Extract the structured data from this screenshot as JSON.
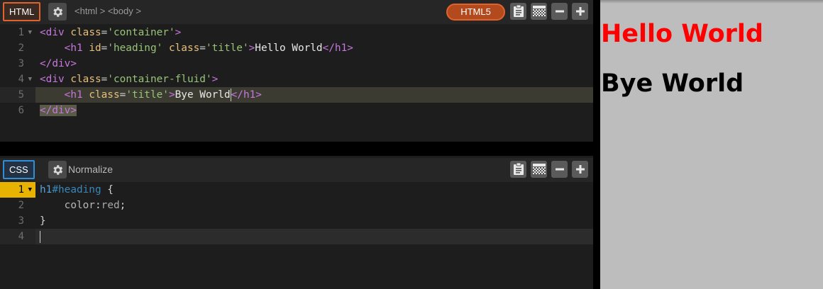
{
  "html_panel": {
    "lang_label": "HTML",
    "breadcrumb": "<html > <body >",
    "doctype_label": "HTML5",
    "lines": [
      {
        "num": "1",
        "fold": true
      },
      {
        "num": "2",
        "fold": false
      },
      {
        "num": "3",
        "fold": false
      },
      {
        "num": "4",
        "fold": true
      },
      {
        "num": "5",
        "fold": false
      },
      {
        "num": "6",
        "fold": false
      }
    ]
  },
  "html_code": {
    "l1": {
      "open": "<div ",
      "attr1": "class",
      "eq1": "=",
      "val1": "'container'",
      "close": ">"
    },
    "l2": {
      "indent": "    ",
      "open": "<h1 ",
      "attr1": "id",
      "eq1": "=",
      "val1": "'heading'",
      "sp": " ",
      "attr2": "class",
      "eq2": "=",
      "val2": "'title'",
      "gt": ">",
      "txt": "Hello World",
      "end": "</h1>"
    },
    "l3": {
      "end": "</div>"
    },
    "l4": {
      "open": "<div ",
      "attr1": "class",
      "eq1": "=",
      "val1": "'container-fluid'",
      "close": ">"
    },
    "l5": {
      "indent": "    ",
      "open": "<h1 ",
      "attr1": "class",
      "eq1": "=",
      "val1": "'title'",
      "gt": ">",
      "txt": "Bye World",
      "end": "</h1>"
    },
    "l6": {
      "end": "</div>"
    }
  },
  "css_panel": {
    "lang_label": "CSS",
    "preprocessor_label": "Normalize",
    "lines": [
      {
        "num": "1",
        "fold": true
      },
      {
        "num": "2",
        "fold": false
      },
      {
        "num": "3",
        "fold": false
      },
      {
        "num": "4",
        "fold": false
      }
    ]
  },
  "css_code": {
    "l1": {
      "sel": "h1",
      "id": "#heading",
      "brace": " {"
    },
    "l2": {
      "indent": "    ",
      "prop": "color",
      "colon": ":",
      "val": "red",
      "semi": ";"
    },
    "l3": {
      "brace": "}"
    }
  },
  "preview": {
    "heading1": "Hello World",
    "heading2": "Bye World"
  },
  "icons": {
    "settings": "gear-icon",
    "tidy": "clipboard-icon",
    "color": "checkerboard-icon",
    "collapse": "minus-icon",
    "expand": "plus-icon"
  },
  "colors": {
    "html_accent": "#e0622d",
    "css_accent": "#2f8fd6",
    "active_line_number": "#e8b200",
    "preview_bg": "#bdbdbd",
    "heading_red": "#ff0000"
  }
}
